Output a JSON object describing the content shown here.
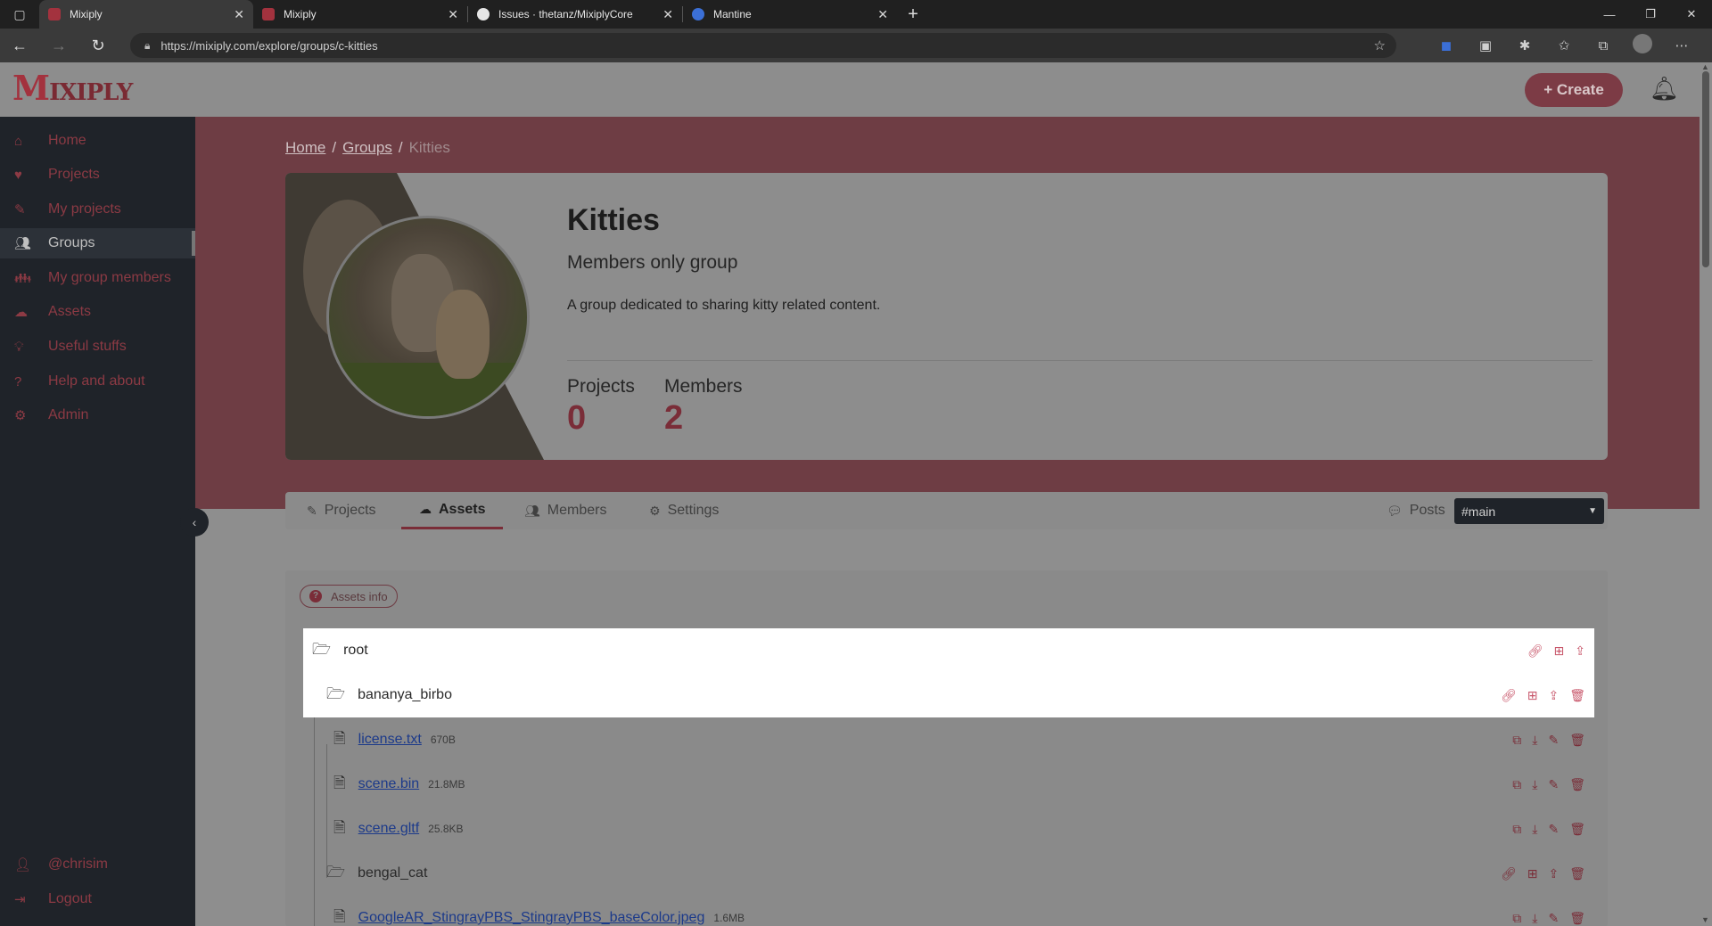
{
  "browser": {
    "tabs": [
      {
        "title": "Mixiply",
        "active": true,
        "favicon_color": "#a3323e"
      },
      {
        "title": "Mixiply",
        "active": false,
        "favicon_color": "#a3323e"
      },
      {
        "title": "Issues · thetanz/MixiplyCore",
        "active": false,
        "favicon_color": "#e6e6e6"
      },
      {
        "title": "Mantine",
        "active": false,
        "favicon_color": "#3b6fd6"
      }
    ],
    "url": "https://mixiply.com/explore/groups/c-kitties"
  },
  "app": {
    "logo_text": "IXIPLY",
    "logo_initial": "M",
    "create_label": "+ Create"
  },
  "sidebar": {
    "items": [
      {
        "label": "Home",
        "icon": "home-icon",
        "glyph": "⌂",
        "active": false
      },
      {
        "label": "Projects",
        "icon": "heart-icon",
        "glyph": "♥",
        "active": false
      },
      {
        "label": "My projects",
        "icon": "brush-icon",
        "glyph": "✎",
        "active": false
      },
      {
        "label": "Groups",
        "icon": "users-icon",
        "glyph": "👥",
        "active": true
      },
      {
        "label": "My group members",
        "icon": "user-group-icon",
        "glyph": "👪",
        "active": false
      },
      {
        "label": "Assets",
        "icon": "cloud-icon",
        "glyph": "☁",
        "active": false
      },
      {
        "label": "Useful stuffs",
        "icon": "lightbulb-icon",
        "glyph": "💡",
        "active": false
      },
      {
        "label": "Help and about",
        "icon": "question-icon",
        "glyph": "?",
        "active": false
      },
      {
        "label": "Admin",
        "icon": "user-cog-icon",
        "glyph": "⚙",
        "active": false
      }
    ],
    "bottom": [
      {
        "label": "@chrisim",
        "icon": "user-icon",
        "glyph": "👤"
      },
      {
        "label": "Logout",
        "icon": "logout-icon",
        "glyph": "⇥"
      }
    ]
  },
  "breadcrumb": {
    "items": [
      "Home",
      "Groups"
    ],
    "current": "Kitties"
  },
  "group": {
    "title": "Kitties",
    "subtitle": "Members only group",
    "description": "A group dedicated to sharing kitty related content.",
    "stats": [
      {
        "label": "Projects",
        "value": "0"
      },
      {
        "label": "Members",
        "value": "2"
      }
    ]
  },
  "tabs": {
    "items": [
      {
        "label": "Projects",
        "icon": "brush-icon",
        "glyph": "✎",
        "active": false
      },
      {
        "label": "Assets",
        "icon": "cloud-icon",
        "glyph": "☁",
        "active": true
      },
      {
        "label": "Members",
        "icon": "users-icon",
        "glyph": "👥",
        "active": false
      },
      {
        "label": "Settings",
        "icon": "gear-icon",
        "glyph": "⚙",
        "active": false
      }
    ],
    "posts_label": "Posts",
    "channel_value": "#main"
  },
  "assets": {
    "info_label": "Assets info",
    "rows": [
      {
        "type": "folder",
        "name": "root",
        "size": "",
        "highlight": true
      },
      {
        "type": "folder",
        "name": "bananya_birbo",
        "size": "",
        "highlight": true
      },
      {
        "type": "file",
        "name": "license.txt",
        "size": "670B",
        "highlight": false
      },
      {
        "type": "file",
        "name": "scene.bin",
        "size": "21.8MB",
        "highlight": false
      },
      {
        "type": "file",
        "name": "scene.gltf",
        "size": "25.8KB",
        "highlight": false
      },
      {
        "type": "folder",
        "name": "bengal_cat",
        "size": "",
        "highlight": false
      },
      {
        "type": "file",
        "name": "GoogleAR_StingrayPBS_StingrayPBS_baseColor.jpeg",
        "size": "1.6MB",
        "highlight": false
      }
    ]
  }
}
